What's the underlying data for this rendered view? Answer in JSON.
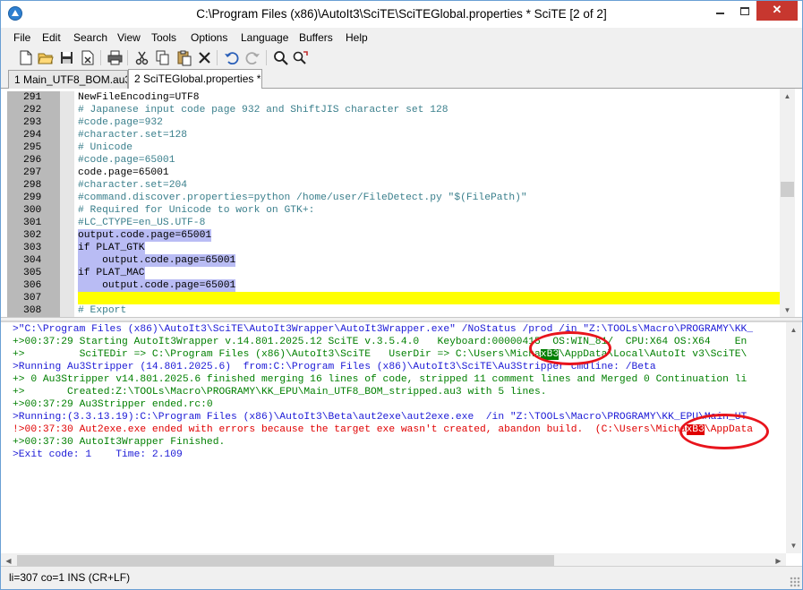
{
  "window": {
    "title": "C:\\Program Files (x86)\\AutoIt3\\SciTE\\SciTEGlobal.properties * SciTE [2 of 2]",
    "app_icon": "scite-icon"
  },
  "menu": [
    "File",
    "Edit",
    "Search",
    "View",
    "Tools",
    "Options",
    "Language",
    "Buffers",
    "Help"
  ],
  "toolbar": [
    "new-file-icon",
    "open-folder-icon",
    "save-icon",
    "close-file-icon",
    "print-icon",
    "cut-icon",
    "copy-icon",
    "paste-icon",
    "delete-icon",
    "undo-icon",
    "redo-icon",
    "find-icon",
    "replace-icon"
  ],
  "tabs": [
    {
      "label": "1 Main_UTF8_BOM.au3",
      "active": false
    },
    {
      "label": "2 SciTEGlobal.properties *",
      "active": true
    }
  ],
  "editor": {
    "lines": [
      {
        "n": "291",
        "text": "NewFileEncoding=UTF8",
        "kind": "plain"
      },
      {
        "n": "292",
        "text": "# Japanese input code page 932 and ShiftJIS character set 128",
        "kind": "comment"
      },
      {
        "n": "293",
        "text": "#code.page=932",
        "kind": "comment"
      },
      {
        "n": "294",
        "text": "#character.set=128",
        "kind": "comment"
      },
      {
        "n": "295",
        "text": "# Unicode",
        "kind": "comment"
      },
      {
        "n": "296",
        "text": "#code.page=65001",
        "kind": "comment"
      },
      {
        "n": "297",
        "text": "code.page=65001",
        "kind": "plain"
      },
      {
        "n": "298",
        "text": "#character.set=204",
        "kind": "comment"
      },
      {
        "n": "299",
        "text": "#command.discover.properties=python /home/user/FileDetect.py \"$(FilePath)\"",
        "kind": "comment"
      },
      {
        "n": "300",
        "text": "# Required for Unicode to work on GTK+:",
        "kind": "comment"
      },
      {
        "n": "301",
        "text": "#LC_CTYPE=en_US.UTF-8",
        "kind": "comment"
      },
      {
        "n": "302",
        "text": "output.code.page=65001",
        "kind": "selected"
      },
      {
        "n": "303",
        "text": "if PLAT_GTK",
        "kind": "selected"
      },
      {
        "n": "304",
        "text": "    output.code.page=65001",
        "kind": "selected"
      },
      {
        "n": "305",
        "text": "if PLAT_MAC",
        "kind": "selected"
      },
      {
        "n": "306",
        "text": "    output.code.page=65001",
        "kind": "selected"
      },
      {
        "n": "307",
        "text": "",
        "kind": "caret"
      },
      {
        "n": "308",
        "text": "# Export",
        "kind": "comment"
      }
    ]
  },
  "output": {
    "lines": [
      {
        "kind": "blue",
        "parts": [
          ">\"C:\\Program Files (x86)\\AutoIt3\\SciTE\\AutoIt3Wrapper\\AutoIt3Wrapper.exe\" /NoStatus /prod /in \"Z:\\TOOLs\\Macro\\PROGRAMY\\KK_"
        ]
      },
      {
        "kind": "green",
        "parts": [
          "+>00:37:29 Starting AutoIt3Wrapper v.14.801.2025.12 SciTE v.3.5.4.0   Keyboard:00000415  OS:WIN_81/  CPU:X64 OS:X64    En"
        ]
      },
      {
        "kind": "green",
        "parts": [
          "+>         SciTEDir => C:\\Program Files (x86)\\AutoIt3\\SciTE   UserDir => C:\\Users\\Micha",
          "xB3",
          "\\AppData\\Local\\AutoIt v3\\SciTE\\"
        ]
      },
      {
        "kind": "blue",
        "parts": [
          ">Running Au3Stripper (14.801.2025.6)  from:C:\\Program Files (x86)\\AutoIt3\\SciTE\\Au3Stripper cmdline: /Beta"
        ]
      },
      {
        "kind": "green",
        "parts": [
          "+> 0 Au3Stripper v14.801.2025.6 finished merging 16 lines of code, stripped 11 comment lines and Merged 0 Continuation li"
        ]
      },
      {
        "kind": "green",
        "parts": [
          "+>       Created:Z:\\TOOLs\\Macro\\PROGRAMY\\KK_EPU\\Main_UTF8_BOM_stripped.au3 with 5 lines."
        ]
      },
      {
        "kind": "green",
        "parts": [
          "+>00:37:29 Au3Stripper ended.rc:0"
        ]
      },
      {
        "kind": "blue",
        "parts": [
          ">Running:(3.3.13.19):C:\\Program Files (x86)\\AutoIt3\\Beta\\aut2exe\\aut2exe.exe  /in \"Z:\\TOOLs\\Macro\\PROGRAMY\\KK_EPU\\Main_UT"
        ]
      },
      {
        "kind": "red",
        "parts": [
          "!>00:37:30 Aut2exe.exe ended with errors because the target exe wasn't created, abandon build.  (C:\\Users\\Micha",
          "xB3",
          "\\AppData"
        ]
      },
      {
        "kind": "green",
        "parts": [
          "+>00:37:30 AutoIt3Wrapper Finished."
        ]
      },
      {
        "kind": "blue",
        "parts": [
          ">Exit code: 1    Time: 2.109"
        ]
      }
    ]
  },
  "status": "li=307 co=1 INS (CR+LF)",
  "colors": {
    "comment": "#3a7f8c",
    "selection": "#b9bcf4",
    "caret_line": "#ffff00",
    "output_blue": "#1b19d6",
    "output_green": "#007f00",
    "output_red": "#e00000",
    "annotation_circle": "#e8141c"
  }
}
